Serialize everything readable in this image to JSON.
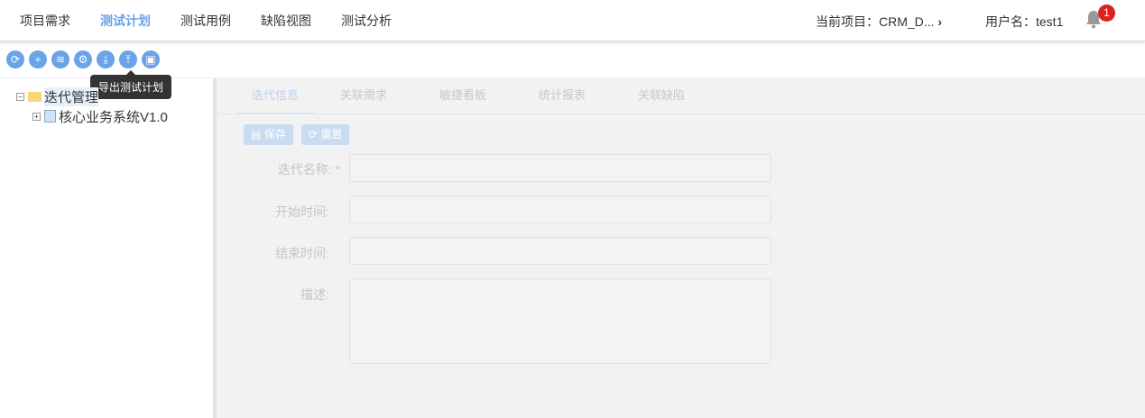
{
  "nav": {
    "items": [
      "项目需求",
      "测试计划",
      "测试用例",
      "缺陷视图",
      "测试分析"
    ],
    "active": 1
  },
  "header": {
    "project": "当前项目：CRM_D...",
    "user": "用户名：test1",
    "notifications": "1"
  },
  "toolbar": {
    "tooltip": "导出测试计划"
  },
  "tree": {
    "root": "迭代管理",
    "child": "核心业务系统V1.0"
  },
  "tabs": [
    "迭代信息",
    "关联需求",
    "敏捷看板",
    "统计报表",
    "关联缺陷"
  ],
  "form": {
    "save": "保存",
    "reset": "重置",
    "name_label": "迭代名称:",
    "required": "*",
    "start_label": "开始时间:",
    "end_label": "结束时间:",
    "desc_label": "描述:"
  }
}
